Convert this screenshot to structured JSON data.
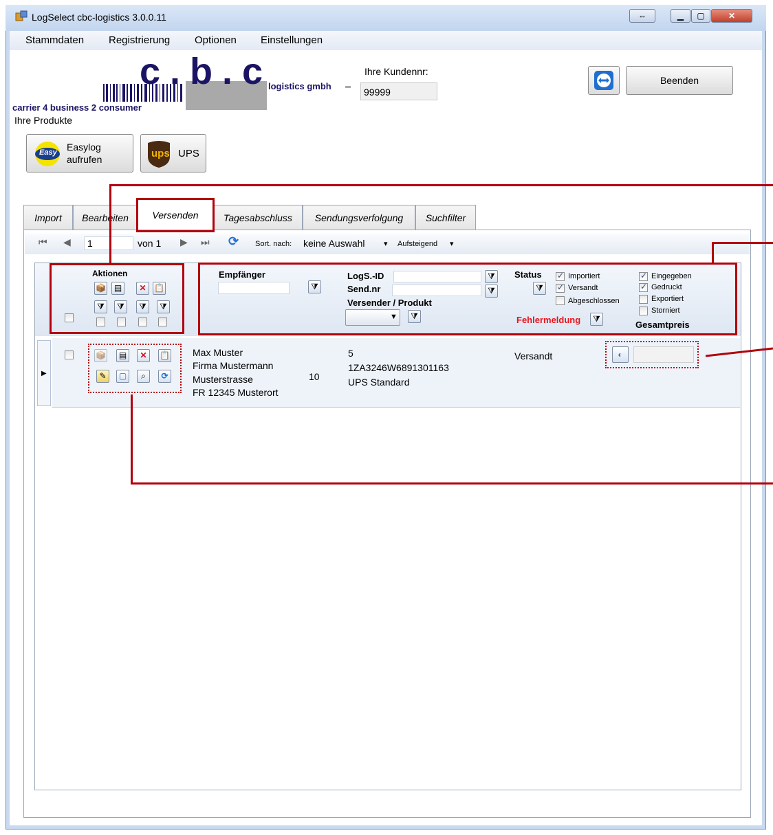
{
  "window": {
    "title": "LogSelect cbc-logistics 3.0.0.11"
  },
  "menu": [
    "Stammdaten",
    "Registrierung",
    "Optionen",
    "Einstellungen"
  ],
  "logo": {
    "brand": "c.b.c",
    "suffix": "logistics gmbh",
    "tagline": "carrier 4 business 2 consumer"
  },
  "customer": {
    "label": "Ihre Kundennr:",
    "value": "99999"
  },
  "quit_button": "Beenden",
  "products": {
    "label": "Ihre Produkte",
    "easylog_line1": "Easylog",
    "easylog_line2": "aufrufen",
    "ups": "UPS",
    "ups_logo": "ups",
    "easylog_logo": "Easy"
  },
  "tabs": [
    "Import",
    "Bearbeiten",
    "Versenden",
    "Tagesabschluss",
    "Sendungsverfolgung",
    "Suchfilter"
  ],
  "active_tab": "Versenden",
  "toolbar": {
    "page": "1",
    "of": "von 1",
    "sort_label": "Sort. nach:",
    "sort_value": "keine Auswahl",
    "order_value": "Aufsteigend"
  },
  "header": {
    "aktionen": "Aktionen",
    "empfaenger": "Empfänger",
    "logs_id": "LogS.-ID",
    "send_nr": "Send.nr",
    "versender": "Versender / Produkt",
    "status": "Status",
    "fehlermeldung": "Fehlermeldung",
    "gesamtpreis": "Gesamtpreis",
    "status_checks": [
      {
        "label": "Importiert",
        "checked": true
      },
      {
        "label": "Versandt",
        "checked": true
      },
      {
        "label": "Abgeschlossen",
        "checked": false
      }
    ],
    "state_checks": [
      {
        "label": "Eingegeben",
        "checked": true
      },
      {
        "label": "Gedruckt",
        "checked": true
      },
      {
        "label": "Exportiert",
        "checked": false
      },
      {
        "label": "Storniert",
        "checked": false
      }
    ]
  },
  "row": {
    "recipient": [
      "Max Muster",
      "Firma Mustermann",
      "Musterstrasse",
      "FR  12345 Musterort"
    ],
    "qty": "10",
    "logs_id": "5",
    "tracking": "1ZA3246W6891301163",
    "product": "UPS   Standard",
    "status": "Versandt"
  },
  "colors": {
    "annotation": "#b3000b",
    "error_label": "#e8141c",
    "window_frame": "#c9daf0"
  }
}
